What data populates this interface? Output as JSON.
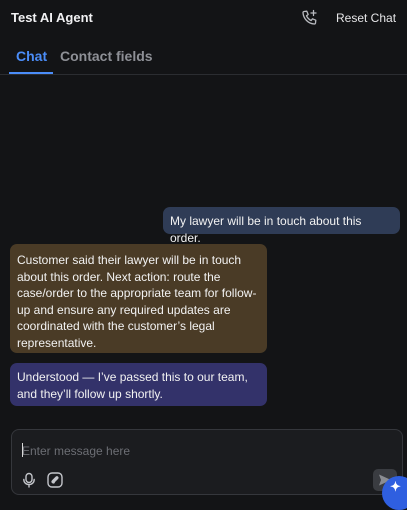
{
  "header": {
    "title": "Test AI Agent",
    "reset_label": "Reset Chat",
    "call_icon": "phone-plus-icon"
  },
  "tabs": [
    {
      "label": "Chat",
      "active": true
    },
    {
      "label": "Contact fields",
      "active": false
    }
  ],
  "messages": [
    {
      "role": "user",
      "text": "My lawyer will be in touch about this order."
    },
    {
      "role": "note",
      "text": "Customer said their lawyer will be in touch about this order. Next action: route the case/order to the appropriate team for follow-up and ensure any required updates are coordinated with the customer’s legal representative."
    },
    {
      "role": "agent",
      "text": "Understood — I’ve passed this to our team, and they’ll follow up shortly."
    }
  ],
  "composer": {
    "placeholder": "Enter message here",
    "value": "",
    "mic_icon": "microphone-icon",
    "attach_icon": "attachment-icon",
    "send_icon": "send-icon"
  },
  "colors": {
    "background": "#131416",
    "accent": "#4b8df8",
    "user_bubble": "#2f3c56",
    "note_bubble": "#4a3b26",
    "agent_bubble": "#33326a"
  }
}
